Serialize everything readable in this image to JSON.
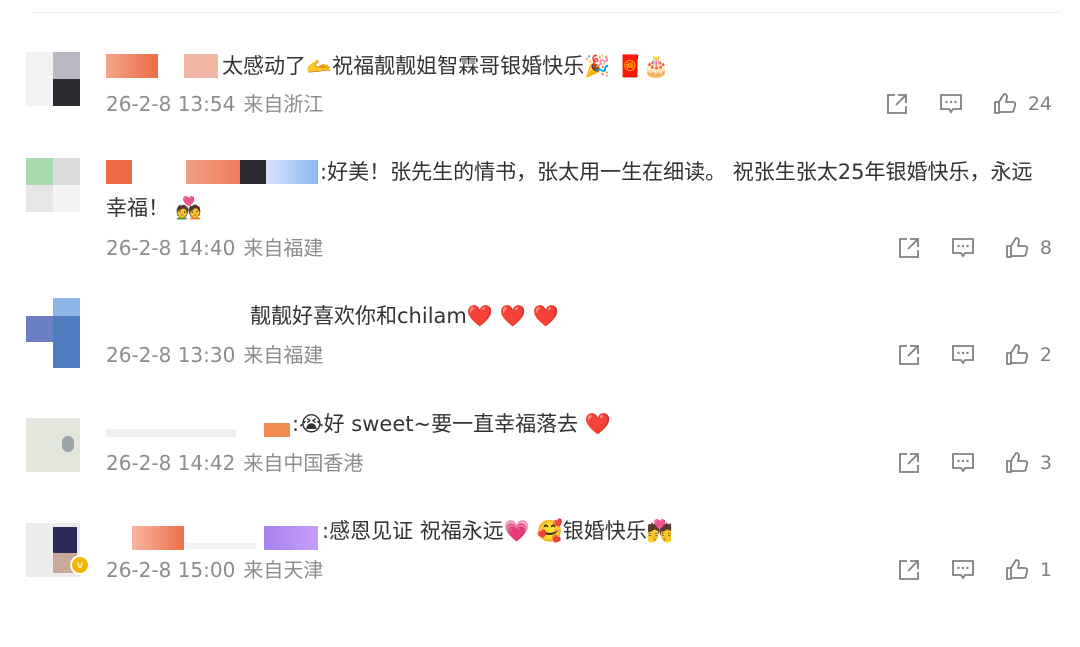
{
  "comments": [
    {
      "text": "太感动了🫴祝福靓靓姐智霖哥银婚快乐🎉 🧧🎂",
      "date": "26-2-8 13:54",
      "location": "来自浙江",
      "likes": "24"
    },
    {
      "text": ":好美！张先生的情书，张太用一生在细读。 祝张生张太25年银婚快乐，永远幸福！ 💑",
      "date": "26-2-8 14:40",
      "location": "来自福建",
      "likes": "8"
    },
    {
      "text": "靓靓好喜欢你和chilam❤️ ❤️ ❤️",
      "date": "26-2-8 13:30",
      "location": "来自福建",
      "likes": "2"
    },
    {
      "text": ":😭好 sweet~要一直幸福落去 ❤️",
      "date": "26-2-8 14:42",
      "location": "来自中国香港",
      "likes": "3"
    },
    {
      "text": ":感恩见证 祝福永远💗 🥰银婚快乐💏",
      "date": "26-2-8 15:00",
      "location": "来自天津",
      "likes": "1"
    }
  ],
  "icons": {
    "share": "share-icon",
    "comment": "comment-icon",
    "like": "like-icon",
    "verified": "verified-badge-icon"
  },
  "colors": {
    "meta_text": "#8c8c8c",
    "body_text": "#333333",
    "verified": "#f5b400"
  }
}
